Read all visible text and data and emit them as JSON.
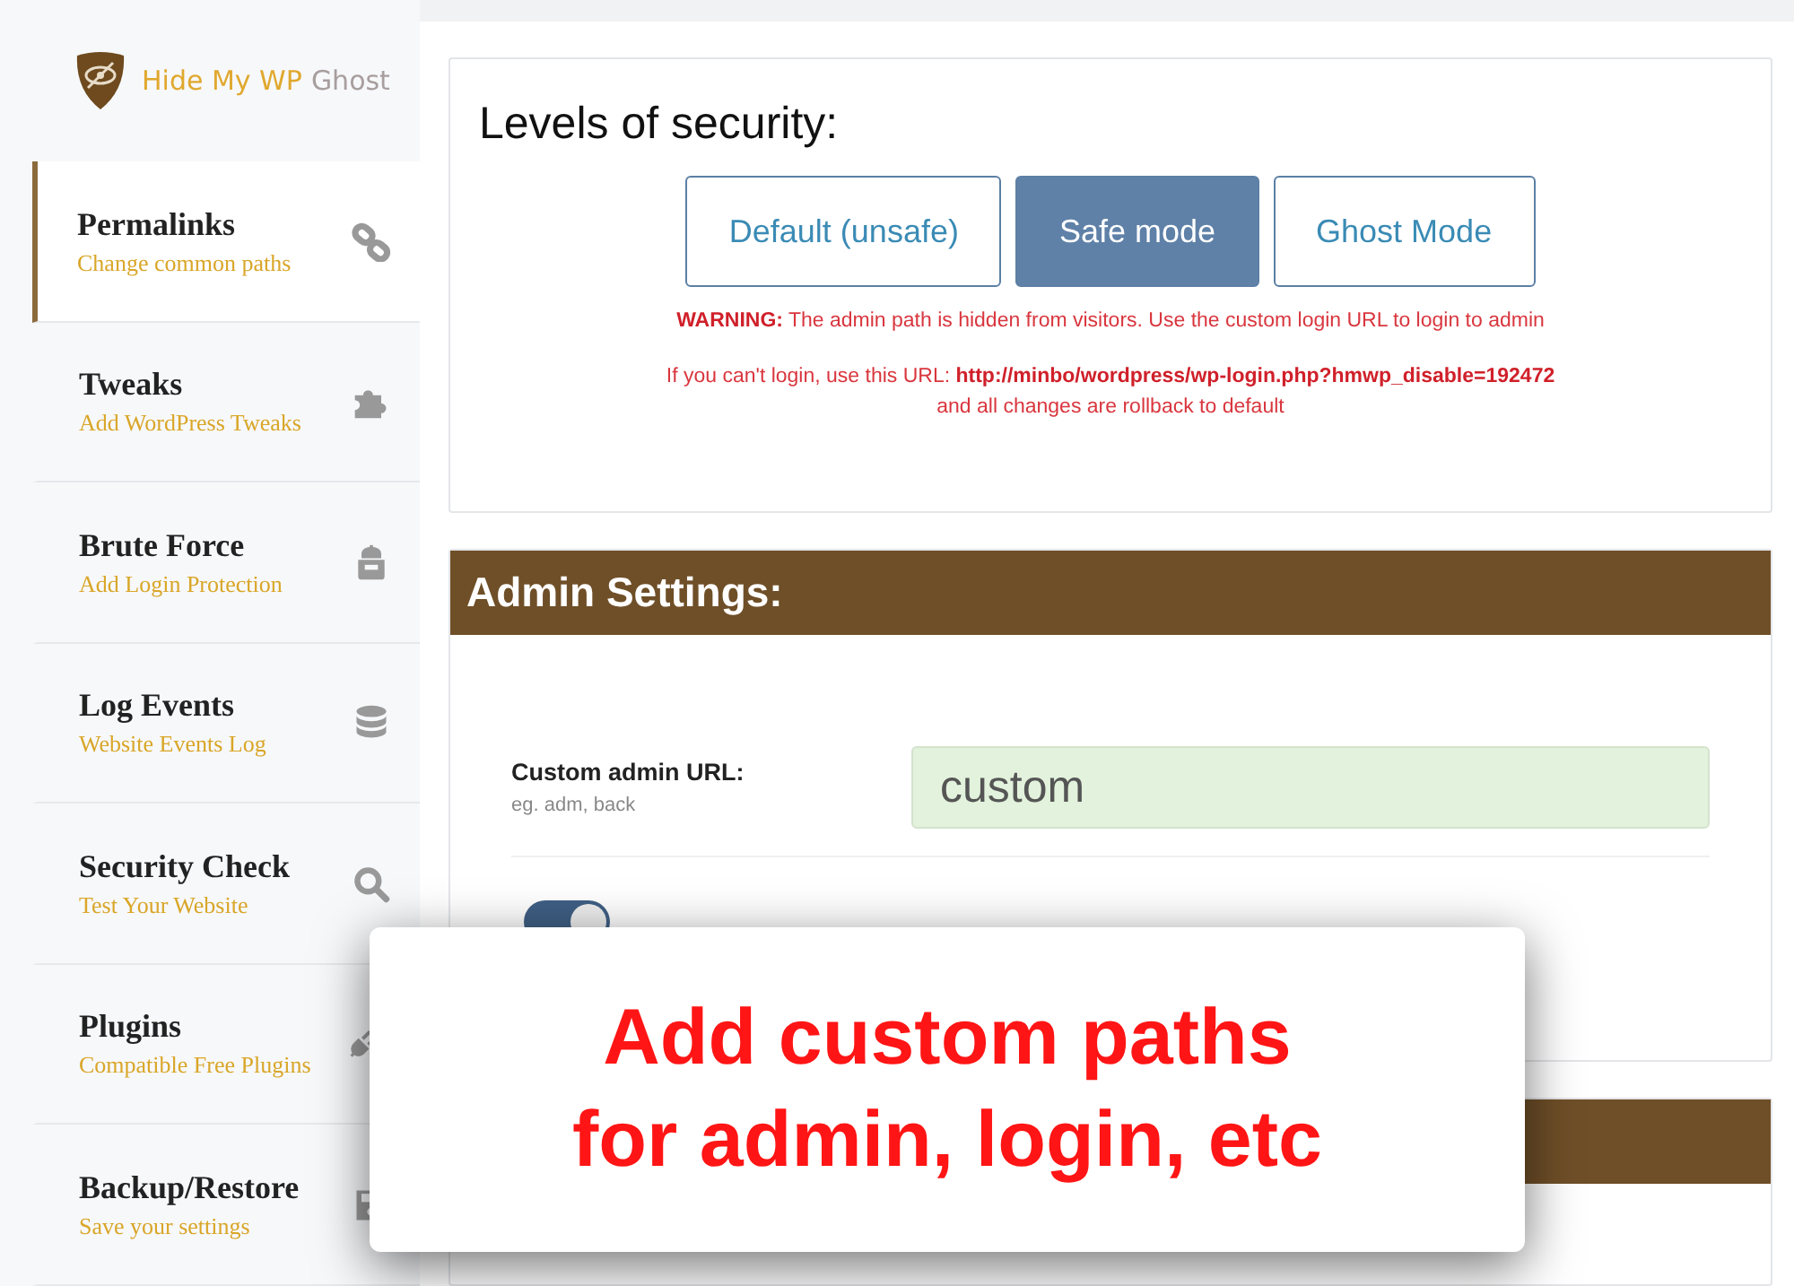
{
  "brand": {
    "name": "Hide My WP",
    "suffix": "Ghost"
  },
  "sidebar": {
    "items": [
      {
        "title": "Permalinks",
        "subtitle": "Change common paths",
        "selected": true
      },
      {
        "title": "Tweaks",
        "subtitle": "Add WordPress Tweaks",
        "selected": false
      },
      {
        "title": "Brute Force",
        "subtitle": "Add Login Protection",
        "selected": false
      },
      {
        "title": "Log Events",
        "subtitle": "Website Events Log",
        "selected": false
      },
      {
        "title": "Security Check",
        "subtitle": "Test Your Website",
        "selected": false
      },
      {
        "title": "Plugins",
        "subtitle": "Compatible Free Plugins",
        "selected": false
      },
      {
        "title": "Backup/Restore",
        "subtitle": "Save your settings",
        "selected": false
      }
    ]
  },
  "levels": {
    "title": "Levels of security:",
    "options": [
      {
        "label": "Default (unsafe)",
        "selected": false
      },
      {
        "label": "Safe mode",
        "selected": true
      },
      {
        "label": "Ghost Mode",
        "selected": false
      }
    ],
    "warning": "**WARNING:** The admin path is hidden from visitors. Use the custom login URL to login to admin",
    "fallback": "If you can't login, use this URL: **http://minbo/wordpress/wp-login.php?hmwp_disable=192472**",
    "fallback_note": "and all changes are rollback to default"
  },
  "admin_settings": {
    "title": "Admin Settings:",
    "custom_admin_url": {
      "label": "Custom admin URL:",
      "hint": "eg. adm, back",
      "value": "custom"
    },
    "hide_wp_admin": {
      "on": true
    }
  },
  "overlay": {
    "text": "Add custom paths for admin, login, etc"
  }
}
